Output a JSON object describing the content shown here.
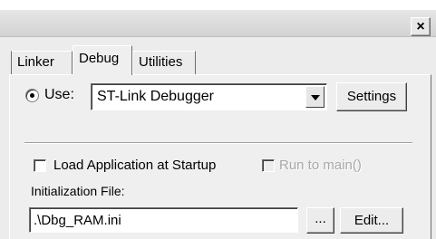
{
  "window": {
    "close_glyph": "×"
  },
  "tabs": [
    {
      "label": "Linker",
      "active": false
    },
    {
      "label": "Debug",
      "active": true
    },
    {
      "label": "Utilities",
      "active": false
    }
  ],
  "debug": {
    "use_label": "Use:",
    "use_selected": true,
    "debugger_value": "ST-Link Debugger",
    "settings_label": "Settings",
    "load_app_label": "Load Application at Startup",
    "load_app_checked": false,
    "run_to_main_label": "Run to main()",
    "run_to_main_enabled": false,
    "init_file_label": "Initialization File:",
    "init_file_value": ".\\Dbg_RAM.ini",
    "browse_label": "...",
    "edit_label": "Edit..."
  }
}
